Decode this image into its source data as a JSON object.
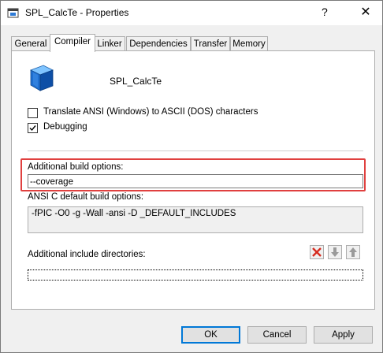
{
  "window": {
    "title": "SPL_CalcTe - Properties",
    "help_label": "?",
    "close_label": "✕"
  },
  "tabs": [
    {
      "label": "General"
    },
    {
      "label": "Compiler",
      "active": true
    },
    {
      "label": "Linker"
    },
    {
      "label": "Dependencies"
    },
    {
      "label": "Transfer"
    },
    {
      "label": "Memory"
    }
  ],
  "project": {
    "name": "SPL_CalcTe",
    "icon": "cube-icon"
  },
  "options": {
    "translate_ansi": {
      "label": "Translate ANSI (Windows) to ASCII (DOS) characters",
      "checked": false
    },
    "debugging": {
      "label": "Debugging",
      "checked": true
    }
  },
  "build": {
    "additional_label": "Additional build options:",
    "additional_value": "--coverage",
    "default_label": "ANSI C default build options:",
    "default_value": "-fPIC -O0 -g -Wall -ansi -D _DEFAULT_INCLUDES"
  },
  "include_dirs": {
    "label": "Additional include directories:",
    "entries": [
      ""
    ],
    "toolbar": [
      "delete-icon",
      "move-down-icon",
      "move-up-icon"
    ]
  },
  "buttons": {
    "ok": "OK",
    "cancel": "Cancel",
    "apply": "Apply"
  },
  "colors": {
    "highlight": "#e0403f",
    "accent": "#0078d7"
  }
}
